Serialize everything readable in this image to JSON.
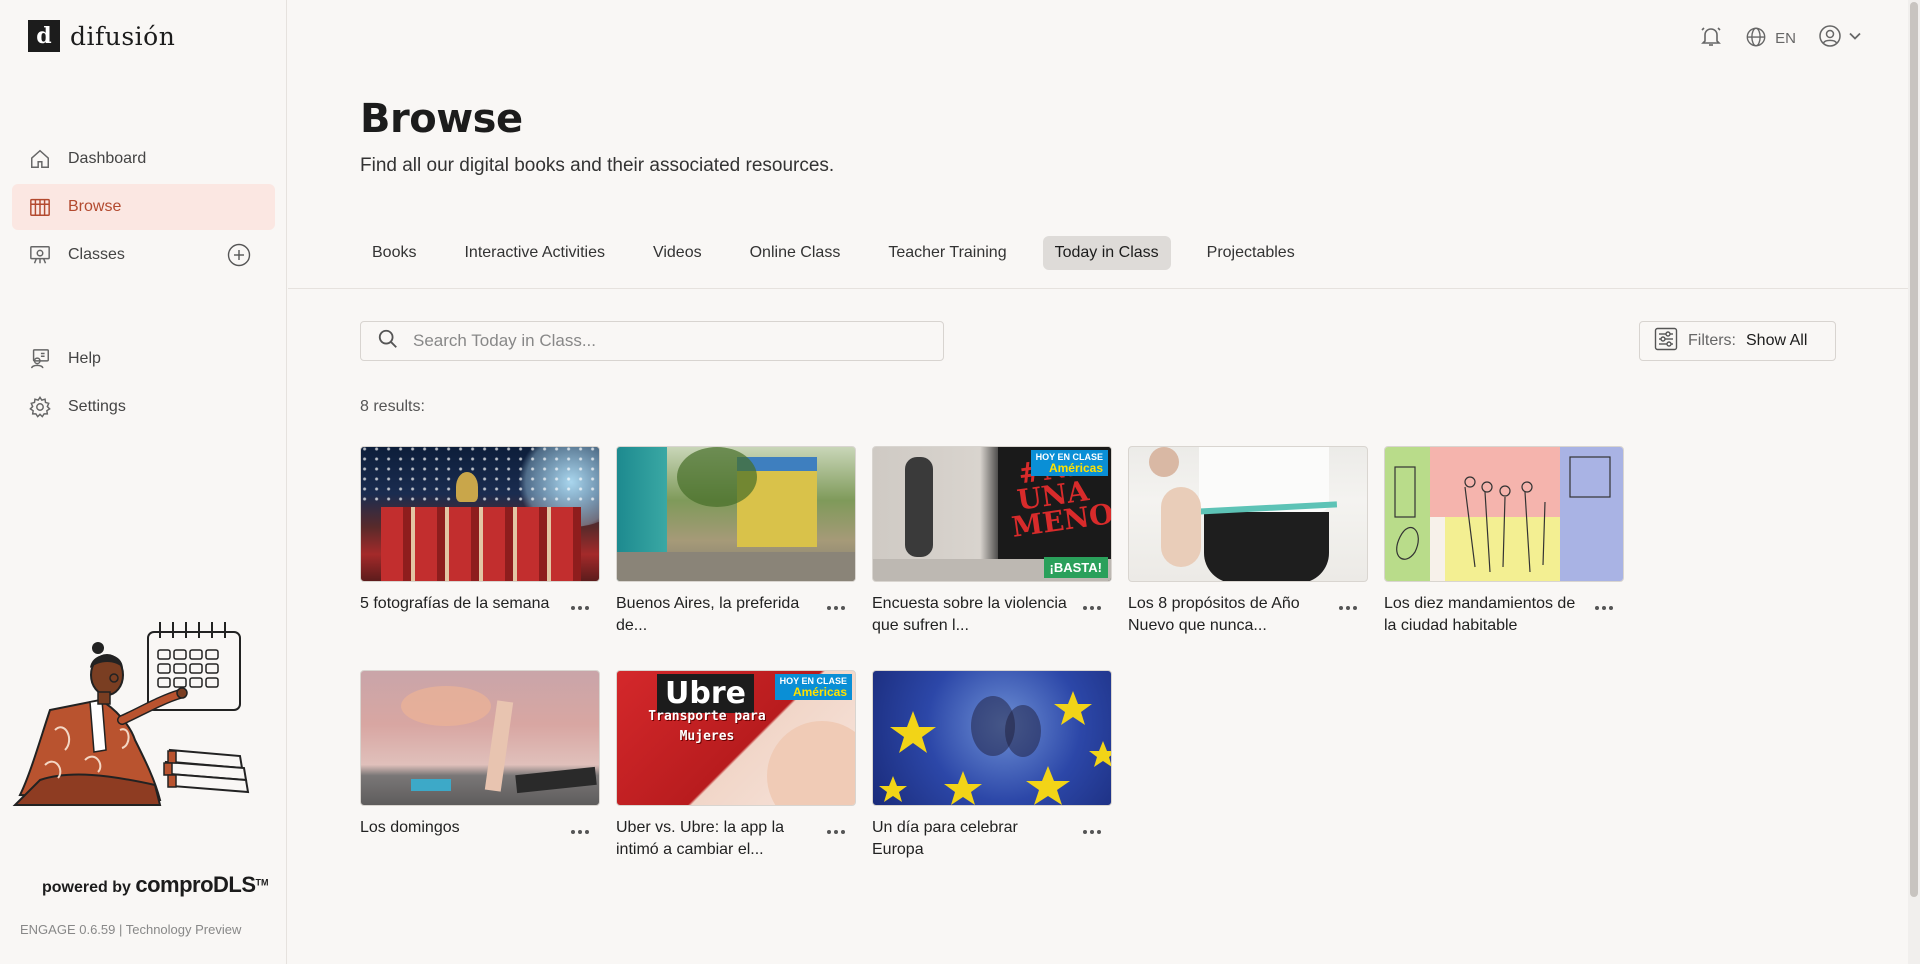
{
  "brand": {
    "logo_letter": "d",
    "name": "difusión"
  },
  "sidebar": {
    "items": [
      {
        "label": "Dashboard",
        "icon": "home-icon"
      },
      {
        "label": "Browse",
        "icon": "browse-icon",
        "active": true
      },
      {
        "label": "Classes",
        "icon": "classes-icon"
      },
      {
        "label": "Help",
        "icon": "help-icon"
      },
      {
        "label": "Settings",
        "icon": "gear-icon"
      }
    ],
    "powered_by": "powered by",
    "powered_brand": "comproDLS",
    "trademark": "TM",
    "version": "ENGAGE 0.6.59 | Technology Preview"
  },
  "topbar": {
    "language": "EN"
  },
  "page": {
    "title": "Browse",
    "subtitle": "Find all our digital books and their associated resources."
  },
  "tabs": [
    {
      "label": "Books"
    },
    {
      "label": "Interactive Activities"
    },
    {
      "label": "Videos"
    },
    {
      "label": "Online Class"
    },
    {
      "label": "Teacher Training"
    },
    {
      "label": "Today in Class",
      "active": true
    },
    {
      "label": "Projectables"
    }
  ],
  "search": {
    "placeholder": "Search Today in Class...",
    "value": ""
  },
  "filters": {
    "label": "Filters:",
    "value": "Show All"
  },
  "results": {
    "count_label": "8 results:",
    "items": [
      {
        "title": "5 fotografías de la semana"
      },
      {
        "title": "Buenos Aires, la preferida de..."
      },
      {
        "title": "Encuesta sobre la violencia que sufren l..."
      },
      {
        "title": "Los 8 propósitos de Año Nuevo que nunca..."
      },
      {
        "title": "Los diez mandamientos de la ciudad habitable"
      },
      {
        "title": "Los domingos"
      },
      {
        "title": "Uber vs. Ubre: la app la intimó a cambiar el..."
      },
      {
        "title": "Un día para celebrar Europa"
      }
    ]
  },
  "thumb_text": {
    "hoy_en_clase": "HOY EN CLASE",
    "americas": "Américas",
    "basta": "¡BASTA!",
    "graffiti": "#NI UNA MENOS",
    "ubre": "Ubre",
    "ubre_sub": "Transporte para Mujeres"
  },
  "colors": {
    "accent": "#b34a2f",
    "active_nav_bg": "#fbe7e2",
    "active_tab_bg": "#dedbd8",
    "background": "#f9f7f5"
  }
}
